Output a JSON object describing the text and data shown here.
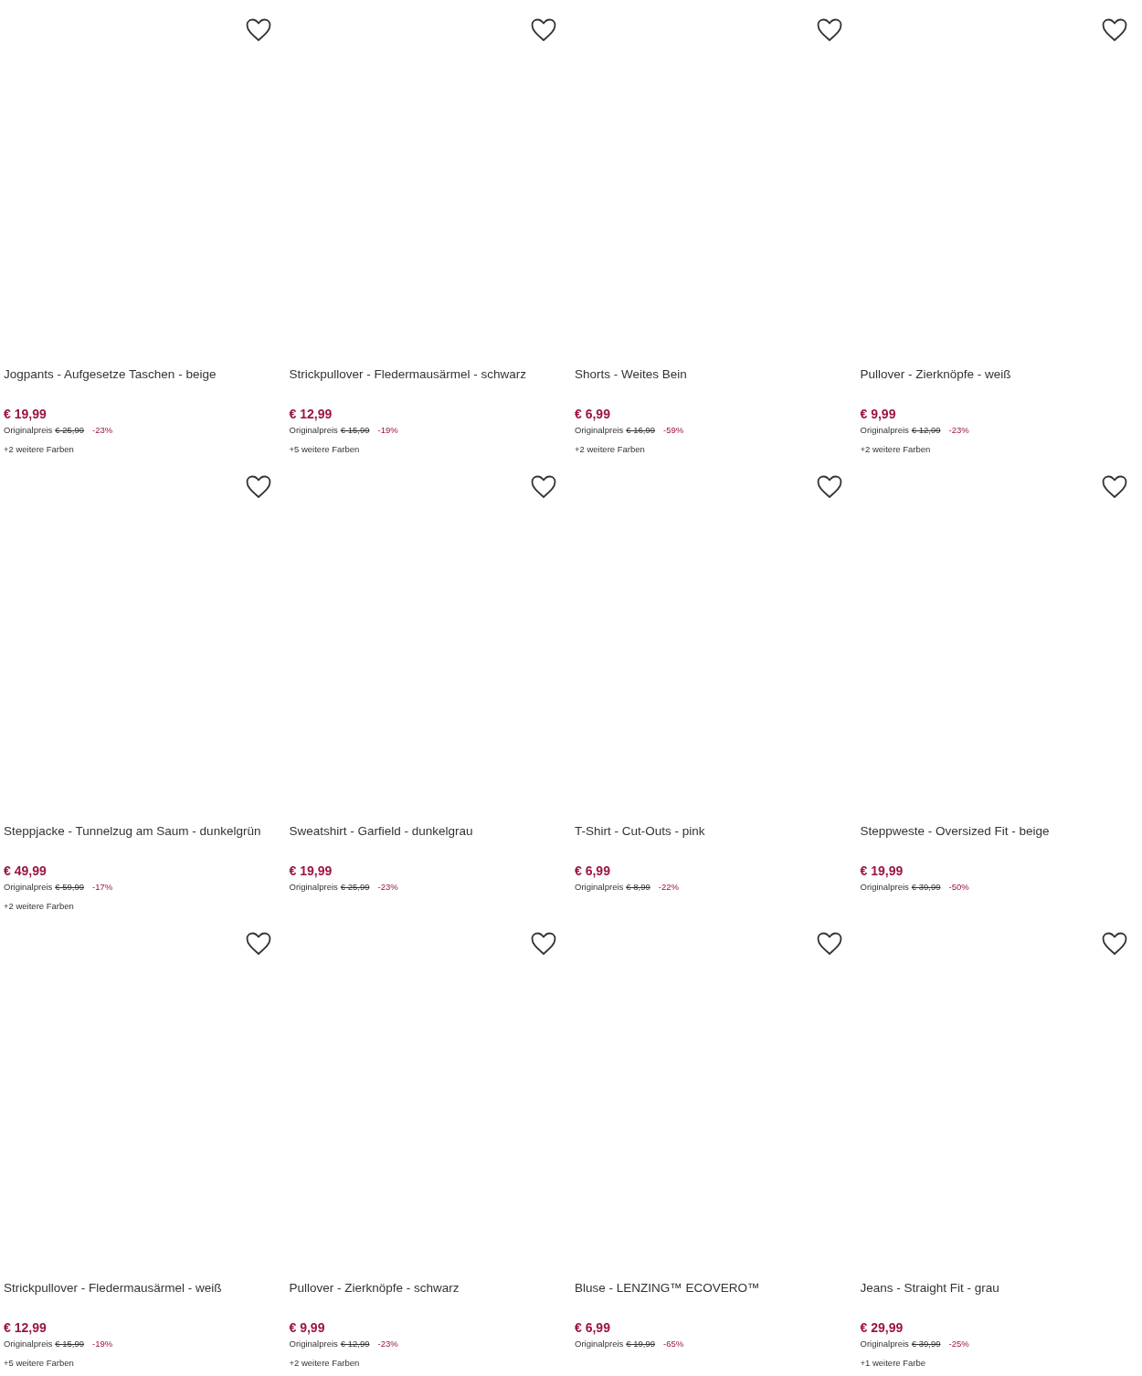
{
  "products": [
    {
      "title": "Jogpants - Aufgesetze Taschen - beige",
      "price": "€ 19,99",
      "original_label": "Originalpreis",
      "original_price": "€ 25,99",
      "discount": "-23%",
      "more_colors": "+2 weitere Farben"
    },
    {
      "title": "Strickpullover - Fledermausärmel - schwarz",
      "price": "€ 12,99",
      "original_label": "Originalpreis",
      "original_price": "€ 15,99",
      "discount": "-19%",
      "more_colors": "+5 weitere Farben"
    },
    {
      "title": "Shorts - Weites Bein",
      "price": "€ 6,99",
      "original_label": "Originalpreis",
      "original_price": "€ 16,99",
      "discount": "-59%",
      "more_colors": "+2 weitere Farben"
    },
    {
      "title": "Pullover - Zierknöpfe - weiß",
      "price": "€ 9,99",
      "original_label": "Originalpreis",
      "original_price": "€ 12,99",
      "discount": "-23%",
      "more_colors": "+2 weitere Farben"
    },
    {
      "title": "Steppjacke - Tunnelzug am Saum - dunkelgrün",
      "price": "€ 49,99",
      "original_label": "Originalpreis",
      "original_price": "€ 59,99",
      "discount": "-17%",
      "more_colors": "+2 weitere Farben"
    },
    {
      "title": "Sweatshirt - Garfield - dunkelgrau",
      "price": "€ 19,99",
      "original_label": "Originalpreis",
      "original_price": "€ 25,99",
      "discount": "-23%"
    },
    {
      "title": "T-Shirt - Cut-Outs - pink",
      "price": "€ 6,99",
      "original_label": "Originalpreis",
      "original_price": "€ 8,99",
      "discount": "-22%"
    },
    {
      "title": "Steppweste - Oversized Fit - beige",
      "price": "€ 19,99",
      "original_label": "Originalpreis",
      "original_price": "€ 39,99",
      "discount": "-50%"
    },
    {
      "title": "Strickpullover - Fledermausärmel - weiß",
      "price": "€ 12,99",
      "original_label": "Originalpreis",
      "original_price": "€ 15,99",
      "discount": "-19%",
      "more_colors": "+5 weitere Farben"
    },
    {
      "title": "Pullover - Zierknöpfe - schwarz",
      "price": "€ 9,99",
      "original_label": "Originalpreis",
      "original_price": "€ 12,99",
      "discount": "-23%",
      "more_colors": "+2 weitere Farben"
    },
    {
      "title": "Bluse - LENZING™ ECOVERO™",
      "price": "€ 6,99",
      "original_label": "Originalpreis",
      "original_price": "€ 19,99",
      "discount": "-65%"
    },
    {
      "title": "Jeans - Straight Fit - grau",
      "price": "€ 29,99",
      "original_label": "Originalpreis",
      "original_price": "€ 39,99",
      "discount": "-25%",
      "more_colors": "+1 weitere Farbe"
    }
  ]
}
